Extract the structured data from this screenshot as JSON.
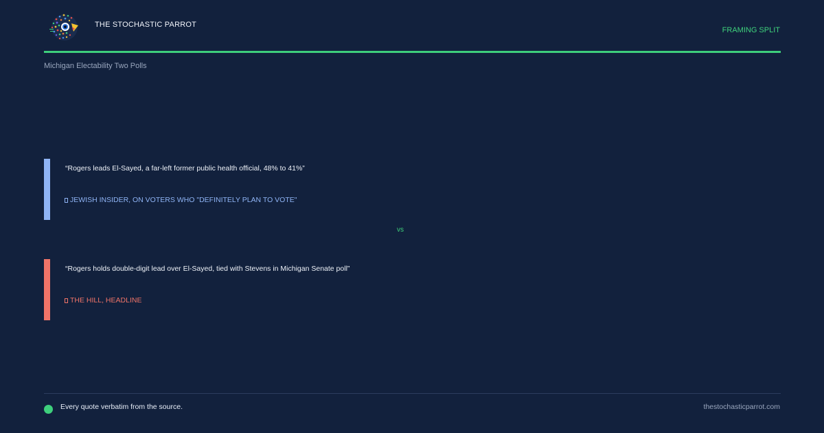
{
  "header": {
    "brand_name": "THE STOCHASTIC PARROT",
    "framing_tag": "FRAMING SPLIT",
    "logo_icon": "parrot-logo-icon",
    "accent_color": "#3ecf7c"
  },
  "subtitle": "Michigan Electability Two Polls",
  "quotes": [
    {
      "text": "“Rogers leads El-Sayed, a far-left former public health official, 48% to 41%”",
      "attribution": "JEWISH INSIDER, ON VOTERS WHO \"DEFINITELY PLAN TO VOTE\"",
      "color": "#8fb4f5"
    },
    {
      "text": "“Rogers holds double-digit lead over El-Sayed, tied with Stevens in Michigan Senate poll”",
      "attribution": "THE HILL, HEADLINE",
      "color": "#f07468"
    }
  ],
  "vs_label": "vs",
  "footer": {
    "note": "Every quote verbatim from the source.",
    "site": "thestochasticparrot.com"
  }
}
